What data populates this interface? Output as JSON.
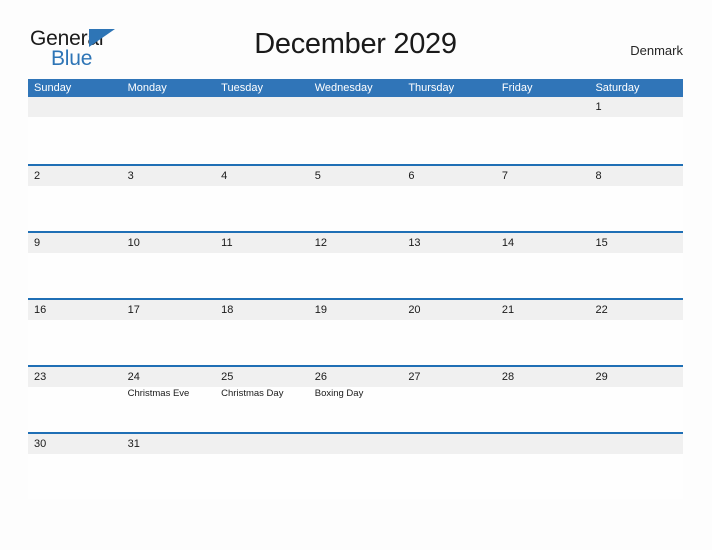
{
  "brand": {
    "name_part1": "General",
    "name_part2": "Blue",
    "triangle_icon": "triangle-icon",
    "color_dark": "#1A1A1A",
    "color_blue": "#2E75B6"
  },
  "header": {
    "title": "December 2029",
    "country": "Denmark"
  },
  "theme": {
    "header_blue": "#3075B8",
    "row_border_blue": "#1F6FB5",
    "date_band_gray": "#F0F0F0",
    "page_background": "#FDFDFD",
    "text_dark": "#1A1A1A"
  },
  "calendar": {
    "month": "December",
    "year": "2029",
    "weekday_headers": [
      "Sunday",
      "Monday",
      "Tuesday",
      "Wednesday",
      "Thursday",
      "Friday",
      "Saturday"
    ],
    "weeks": [
      [
        {
          "date": "",
          "event": ""
        },
        {
          "date": "",
          "event": ""
        },
        {
          "date": "",
          "event": ""
        },
        {
          "date": "",
          "event": ""
        },
        {
          "date": "",
          "event": ""
        },
        {
          "date": "",
          "event": ""
        },
        {
          "date": "1",
          "event": ""
        }
      ],
      [
        {
          "date": "2",
          "event": ""
        },
        {
          "date": "3",
          "event": ""
        },
        {
          "date": "4",
          "event": ""
        },
        {
          "date": "5",
          "event": ""
        },
        {
          "date": "6",
          "event": ""
        },
        {
          "date": "7",
          "event": ""
        },
        {
          "date": "8",
          "event": ""
        }
      ],
      [
        {
          "date": "9",
          "event": ""
        },
        {
          "date": "10",
          "event": ""
        },
        {
          "date": "11",
          "event": ""
        },
        {
          "date": "12",
          "event": ""
        },
        {
          "date": "13",
          "event": ""
        },
        {
          "date": "14",
          "event": ""
        },
        {
          "date": "15",
          "event": ""
        }
      ],
      [
        {
          "date": "16",
          "event": ""
        },
        {
          "date": "17",
          "event": ""
        },
        {
          "date": "18",
          "event": ""
        },
        {
          "date": "19",
          "event": ""
        },
        {
          "date": "20",
          "event": ""
        },
        {
          "date": "21",
          "event": ""
        },
        {
          "date": "22",
          "event": ""
        }
      ],
      [
        {
          "date": "23",
          "event": ""
        },
        {
          "date": "24",
          "event": "Christmas Eve"
        },
        {
          "date": "25",
          "event": "Christmas Day"
        },
        {
          "date": "26",
          "event": "Boxing Day"
        },
        {
          "date": "27",
          "event": ""
        },
        {
          "date": "28",
          "event": ""
        },
        {
          "date": "29",
          "event": ""
        }
      ],
      [
        {
          "date": "30",
          "event": ""
        },
        {
          "date": "31",
          "event": ""
        },
        {
          "date": "",
          "event": ""
        },
        {
          "date": "",
          "event": ""
        },
        {
          "date": "",
          "event": ""
        },
        {
          "date": "",
          "event": ""
        },
        {
          "date": "",
          "event": ""
        }
      ]
    ]
  }
}
